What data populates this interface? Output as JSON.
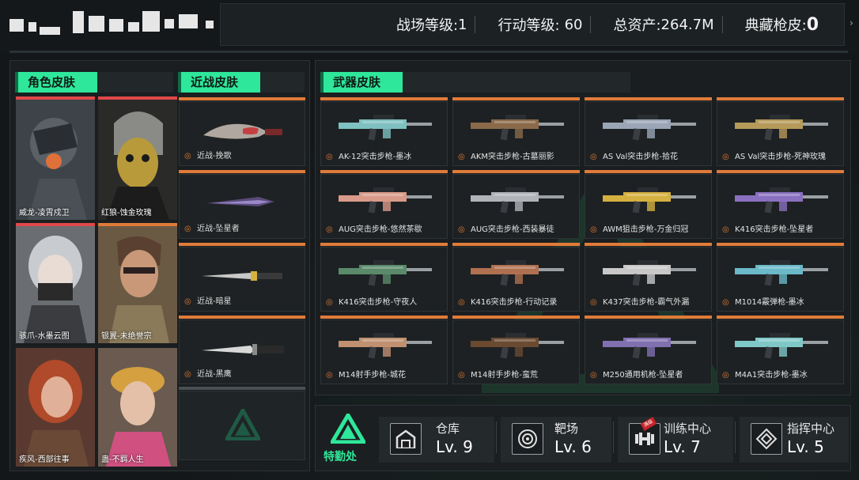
{
  "stats": {
    "battlefield_level_label": "战场等级:",
    "battlefield_level_value": "1",
    "action_level_label": "行动等级:",
    "action_level_value": "60",
    "total_assets_label": "总资产:",
    "total_assets_value": "264.7M",
    "collection_skins_label": "典藏枪皮:",
    "collection_skins_value": "0"
  },
  "sections": {
    "character_skins": "角色皮肤",
    "melee_skins": "近战皮肤",
    "weapon_skins": "武器皮肤"
  },
  "characters": [
    {
      "name": "威龙-凌霄戍卫"
    },
    {
      "name": "红狼-蚀金玫瑰"
    },
    {
      "name": "骇爪-水墨云图"
    },
    {
      "name": "银翼-未绝誉宗"
    },
    {
      "name": "疾风-西部往事"
    },
    {
      "name": "蛊-不羁人生"
    }
  ],
  "melee": [
    {
      "name": "近战-挽歌"
    },
    {
      "name": "近战-坠星者"
    },
    {
      "name": "近战-暗星"
    },
    {
      "name": "近战-黑鹰"
    }
  ],
  "weapons": [
    {
      "name": "AK-12突击步枪-墨冰",
      "color": "#7fc0c0"
    },
    {
      "name": "AKM突击步枪-古墓丽影",
      "color": "#8a6a4a"
    },
    {
      "name": "AS Val突击步枪-拾花",
      "color": "#9aa5b5"
    },
    {
      "name": "AS Val突击步枪-死神玫瑰",
      "color": "#b59a5a"
    },
    {
      "name": "AUG突击步枪-悠然茶歇",
      "color": "#d99a8a"
    },
    {
      "name": "AUG突击步枪-西装暴徒",
      "color": "#b0b4b8"
    },
    {
      "name": "AWM狙击步枪-万金归冠",
      "color": "#d4b040"
    },
    {
      "name": "K416突击步枪-坠星者",
      "color": "#8a70c0"
    },
    {
      "name": "K416突击步枪-守夜人",
      "color": "#5a8a6a"
    },
    {
      "name": "K416突击步枪-行动记录",
      "color": "#b07050"
    },
    {
      "name": "K437突击步枪-霸气外漏",
      "color": "#c8c8c8"
    },
    {
      "name": "M1014霰弹枪-墨冰",
      "color": "#6ab8c8"
    },
    {
      "name": "M14射手步枪-城花",
      "color": "#c09070"
    },
    {
      "name": "M14射手步枪-蛮荒",
      "color": "#6a4a30"
    },
    {
      "name": "M250通用机枪-坠星者",
      "color": "#8070b0"
    },
    {
      "name": "M4A1突击步枪-墨冰",
      "color": "#80c8c8"
    }
  ],
  "bottom": {
    "logo_label": "特勤处",
    "facilities": [
      {
        "title": "仓库",
        "level": "Lv. 9",
        "icon": "warehouse-icon"
      },
      {
        "title": "靶场",
        "level": "Lv. 6",
        "icon": "target-icon"
      },
      {
        "title": "训练中心",
        "level": "Lv. 7",
        "icon": "dumbbell-icon",
        "badge": "满级"
      },
      {
        "title": "指挥中心",
        "level": "Lv. 5",
        "icon": "command-icon"
      }
    ]
  },
  "colors": {
    "accent_green": "#2ee79a",
    "accent_orange": "#e07b39",
    "char_top_red": "#e0484a"
  }
}
